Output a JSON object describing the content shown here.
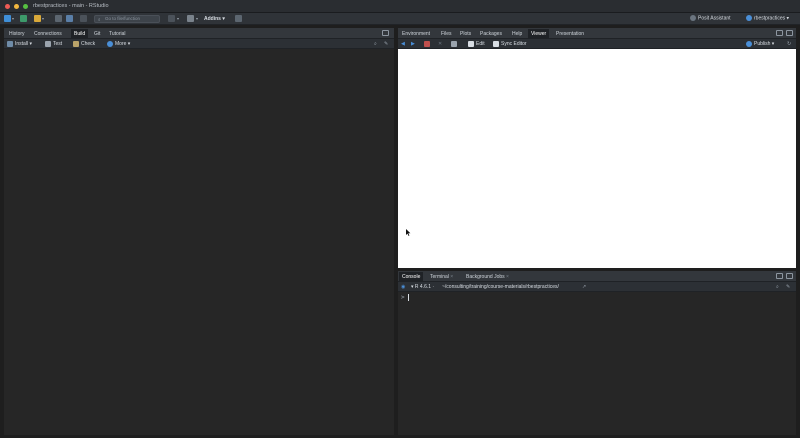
{
  "window": {
    "title": "rbestpractices - main - RStudio"
  },
  "toolbar": {
    "goto_placeholder": "Go to file/function",
    "addins_label": "Addins",
    "posit_assistant_label": "Posit Assistant",
    "project_label": "rbestpractices"
  },
  "left_pane": {
    "tabs": [
      {
        "label": "History"
      },
      {
        "label": "Connections"
      },
      {
        "label": "Build",
        "active": true
      },
      {
        "label": "Git"
      },
      {
        "label": "Tutorial"
      }
    ],
    "tools": {
      "install_label": "Install",
      "test_label": "Test",
      "check_label": "Check",
      "more_label": "More"
    }
  },
  "viewer_pane": {
    "tabs": [
      {
        "label": "Environment"
      },
      {
        "label": "Files"
      },
      {
        "label": "Plots"
      },
      {
        "label": "Packages"
      },
      {
        "label": "Help"
      },
      {
        "label": "Viewer",
        "active": true
      },
      {
        "label": "Presentation"
      }
    ],
    "tools": {
      "edit_label": "Edit",
      "sync_editor_label": "Sync Editor",
      "publish_label": "Publish"
    }
  },
  "console_pane": {
    "tabs": [
      {
        "label": "Console",
        "active": true
      },
      {
        "label": "Terminal"
      },
      {
        "label": "Background Jobs"
      }
    ],
    "r_version": "R 4.6.1",
    "path": "~/consulting/training/course-materials/rbestpractices/",
    "prompt": ">"
  },
  "colors": {
    "background": "#262626",
    "viewer_background": "#ffffff",
    "accent_blue": "#4a8fd8"
  }
}
